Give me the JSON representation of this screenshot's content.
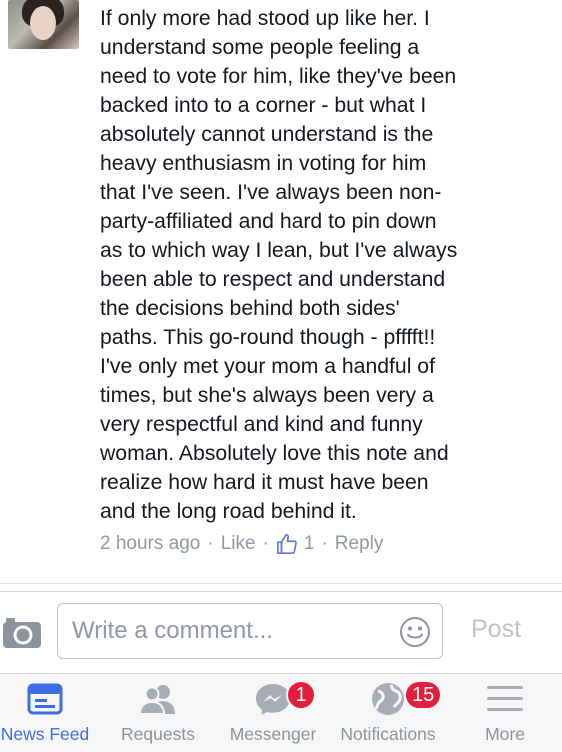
{
  "comment": {
    "text": "If only more had stood up like her. I\nunderstand some people feeling a\nneed to vote for him, like they've been\nbacked into to a corner - but what I\nabsolutely cannot understand is the\nheavy enthusiasm in voting for him\nthat I've seen. I've always been non-\nparty-affiliated and hard to pin down\nas to which way I lean, but I've always\nbeen able to respect and understand\nthe decisions behind both sides'\npaths. This go-round though - pfffft!!\nI've only met your mom a handful of\ntimes, but she's always been very a\nvery respectful and kind and funny\nwoman. Absolutely love this note and\nrealize how hard it must have been\nand the long road behind it.",
    "timestamp": "2 hours ago",
    "like_label": "Like",
    "like_count": "1",
    "reply_label": "Reply",
    "separator": "·"
  },
  "composer": {
    "placeholder": "Write a comment...",
    "post_label": "Post"
  },
  "tabbar": {
    "tabs": [
      {
        "label": "News Feed",
        "icon": "news-feed-icon",
        "active": true
      },
      {
        "label": "Requests",
        "icon": "friend-requests-icon"
      },
      {
        "label": "Messenger",
        "icon": "messenger-icon",
        "badge": "1"
      },
      {
        "label": "Notifications",
        "icon": "globe-icon",
        "badge": "15"
      },
      {
        "label": "More",
        "icon": "menu-icon"
      }
    ]
  },
  "colors": {
    "active_tab": "#3b6ee4",
    "badge": "#e41e3f",
    "meta_text": "#9197a3"
  }
}
